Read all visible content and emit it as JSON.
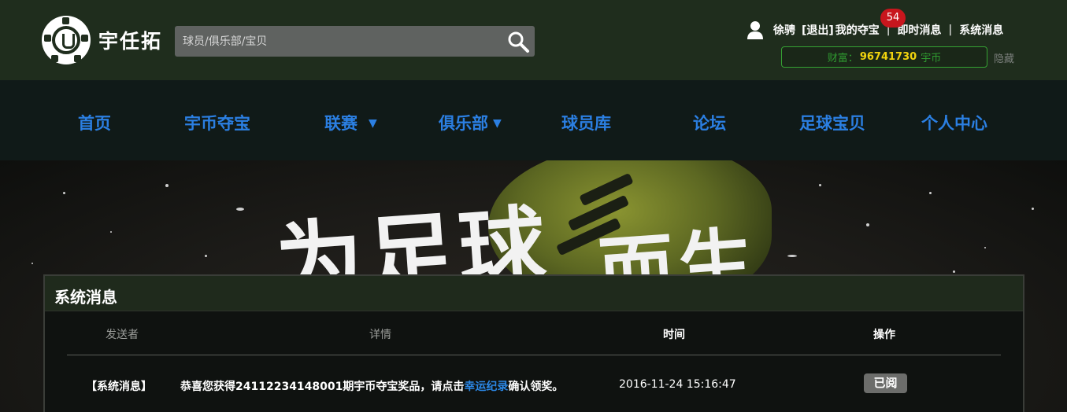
{
  "header": {
    "logo_text": "宇任拓",
    "search": {
      "placeholder": "球员/俱乐部/宝贝"
    },
    "user": {
      "name": "徐骋",
      "logout": "[退出]",
      "my_duobao": "我的夺宝",
      "duobao_count": "54",
      "instant_msg": "即时消息",
      "system_msg": "系统消息",
      "separator": "|"
    },
    "wealth": {
      "label": "财富：",
      "amount": "96741730",
      "unit": "宇币"
    },
    "hide": "隐藏"
  },
  "nav": {
    "items": [
      {
        "label": "首页"
      },
      {
        "label": "宇币夺宝"
      },
      {
        "label": "联赛",
        "arrow": "▼"
      },
      {
        "label": "俱乐部",
        "arrow": "▼"
      },
      {
        "label": "球员库"
      },
      {
        "label": "论坛"
      },
      {
        "label": "足球宝贝"
      },
      {
        "label": "个人中心"
      }
    ]
  },
  "banner": {
    "slogan_left": "为足球",
    "slogan_right": "而生"
  },
  "panel": {
    "title": "系统消息",
    "columns": [
      "发送者",
      "详情",
      "时间",
      "操作"
    ],
    "rows": [
      {
        "sender": "【系统消息】",
        "detail_prefix": "恭喜您获得24112234148001期宇币夺宝奖品，请点击",
        "detail_link": "幸运纪录",
        "detail_suffix": "确认领奖。",
        "time": "2016-11-24 15:16:47",
        "action": "已阅"
      }
    ]
  },
  "colors": {
    "header_bg": "#1f2d1d",
    "nav_bg": "#101a18",
    "nav_text": "#2b7fe2",
    "badge": "#c8161d",
    "wealth_border": "#35a233",
    "wealth_amount": "#f1d30e",
    "link": "#2b88e6"
  }
}
